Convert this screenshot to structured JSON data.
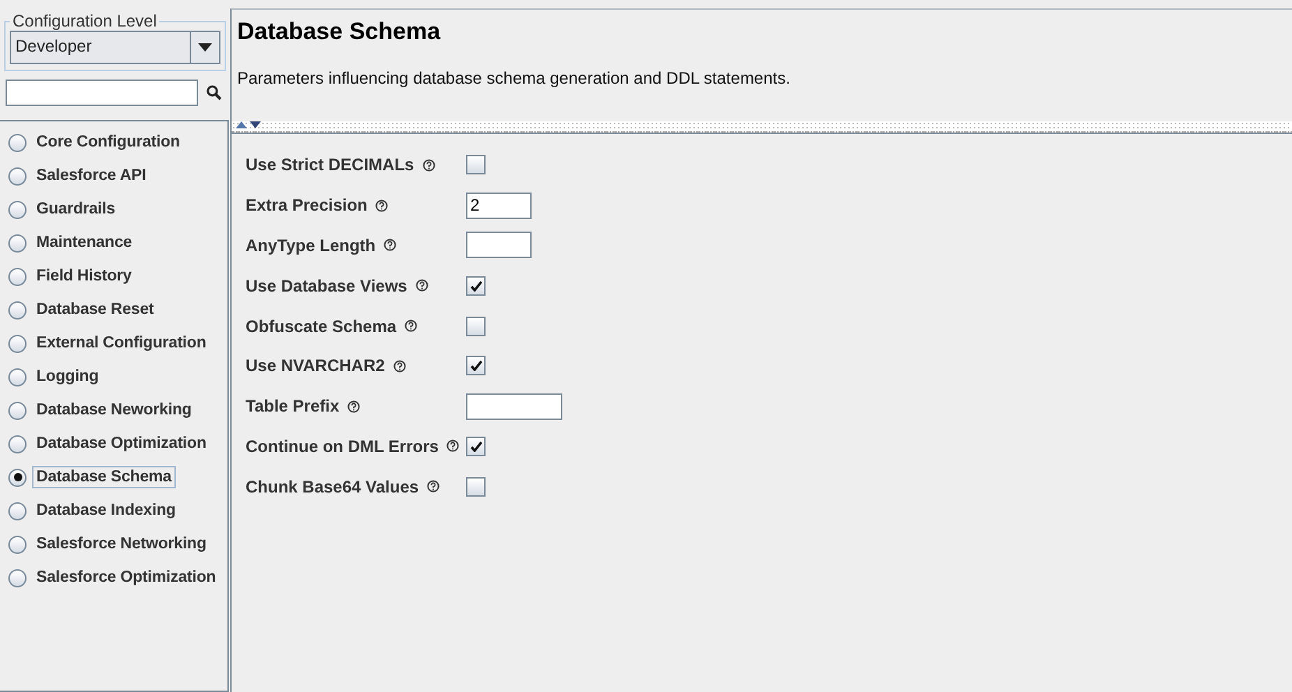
{
  "config_level": {
    "legend": "Configuration Level",
    "value": "Developer"
  },
  "sidebar": {
    "items": [
      {
        "label": "Core Configuration",
        "selected": false
      },
      {
        "label": "Salesforce API",
        "selected": false
      },
      {
        "label": "Guardrails",
        "selected": false
      },
      {
        "label": "Maintenance",
        "selected": false
      },
      {
        "label": "Field History",
        "selected": false
      },
      {
        "label": "Database Reset",
        "selected": false
      },
      {
        "label": "External Configuration",
        "selected": false
      },
      {
        "label": "Logging",
        "selected": false
      },
      {
        "label": "Database Neworking",
        "selected": false
      },
      {
        "label": "Database Optimization",
        "selected": false
      },
      {
        "label": "Database Schema",
        "selected": true
      },
      {
        "label": "Database Indexing",
        "selected": false
      },
      {
        "label": "Salesforce Networking",
        "selected": false
      },
      {
        "label": "Salesforce Optimization",
        "selected": false
      }
    ]
  },
  "header": {
    "title": "Database Schema",
    "description": "Parameters influencing database schema generation and DDL statements."
  },
  "settings": [
    {
      "label": "Use Strict DECIMALs",
      "kind": "checkbox",
      "checked": false
    },
    {
      "label": "Extra Precision",
      "kind": "short-field",
      "value": "2"
    },
    {
      "label": "AnyType Length",
      "kind": "short-field"
    },
    {
      "label": "Use Database Views",
      "kind": "checkbox",
      "checked": true
    },
    {
      "label": "Obfuscate Schema",
      "kind": "checkbox",
      "checked": false
    },
    {
      "label": "Use NVARCHAR2",
      "kind": "checkbox",
      "checked": true
    },
    {
      "label": "Table Prefix",
      "kind": "wide-field"
    },
    {
      "label": "Continue on DML Errors",
      "kind": "checkbox",
      "checked": true
    },
    {
      "label": "Chunk Base64 Values",
      "kind": "checkbox",
      "checked": false
    }
  ]
}
